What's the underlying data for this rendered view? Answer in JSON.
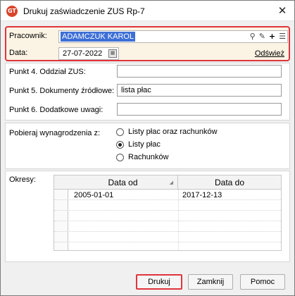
{
  "window": {
    "title": "Drukuj zaświadczenie ZUS Rp-7",
    "app_icon_text": "GT"
  },
  "header": {
    "employee_label": "Pracownik:",
    "employee_value": "ADAMCZUK KAROL",
    "icons": [
      "search-icon",
      "edit-icon",
      "add-icon",
      "list-icon"
    ],
    "date_label": "Data:",
    "date_value": "27-07-2022",
    "refresh_link": "Odśwież"
  },
  "fields": {
    "p4_label": "Punkt 4. Oddział ZUS:",
    "p4_value": "",
    "p5_label": "Punkt 5. Dokumenty źródłowe:",
    "p5_value": "lista płac",
    "p6_label": "Punkt 6. Dodatkowe uwagi:",
    "p6_value": ""
  },
  "wages": {
    "label": "Pobieraj wynagrodzenia z:",
    "options": [
      "Listy płac oraz rachunków",
      "Listy płac",
      "Rachunków"
    ],
    "selected": "Listy płac"
  },
  "periods": {
    "label": "Okresy:",
    "columns": [
      "Data od",
      "Data do"
    ],
    "rows": [
      [
        "2005-01-01",
        "2017-12-13"
      ]
    ]
  },
  "buttons": {
    "print": "Drukuj",
    "close": "Zamknij",
    "help": "Pomoc"
  },
  "colors": {
    "highlight_border": "#e0353c",
    "selection": "#3d6fd6",
    "panel_bg": "#fbf3e4"
  }
}
